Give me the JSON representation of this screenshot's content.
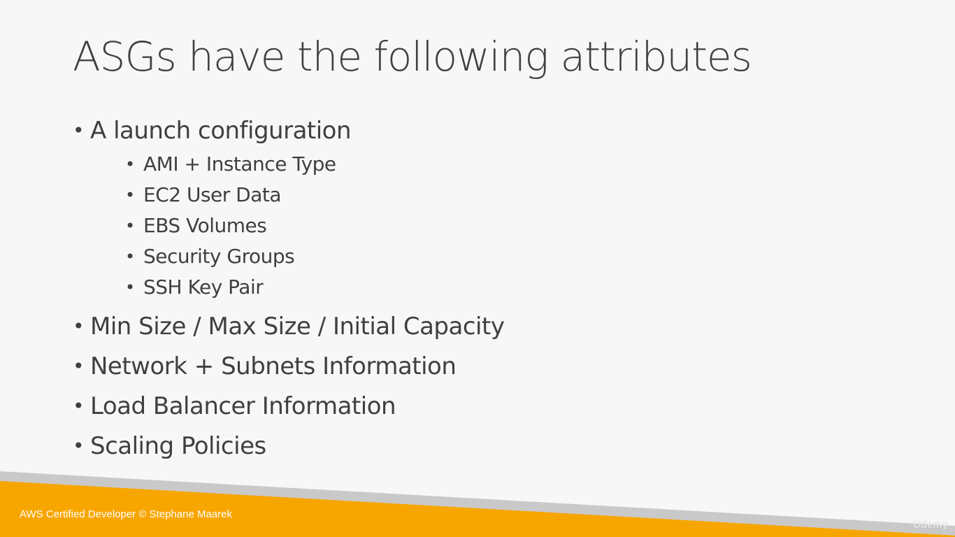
{
  "slide": {
    "title": "ASGs have the following attributes",
    "bullets": [
      {
        "text": "A launch configuration",
        "sub": [
          "AMI + Instance Type",
          "EC2 User Data",
          "EBS Volumes",
          "Security Groups",
          "SSH Key Pair"
        ]
      },
      {
        "text": "Min Size / Max Size / Initial Capacity"
      },
      {
        "text": "Network + Subnets Information"
      },
      {
        "text": "Load Balancer Information"
      },
      {
        "text": "Scaling Policies"
      }
    ]
  },
  "footer": {
    "text": "AWS Certified Developer © Stephane Maarek",
    "watermark": "Udemy"
  },
  "colors": {
    "background": "#f7f7f7",
    "accent": "#f7a600",
    "stripe": "#c9c9c9",
    "text": "#404040"
  }
}
